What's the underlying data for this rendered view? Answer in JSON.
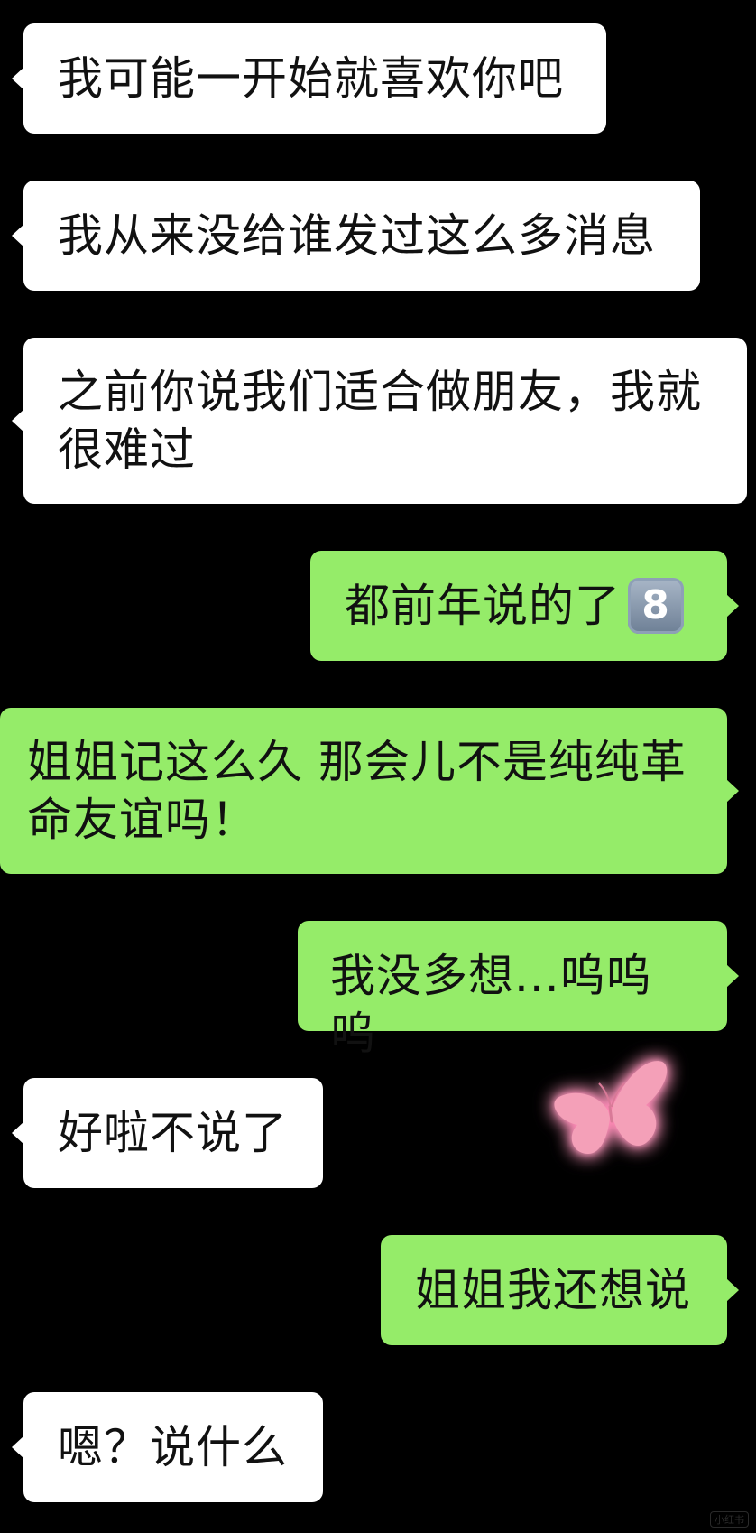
{
  "messages": [
    {
      "side": "in",
      "text": "我可能一开始就喜欢你吧"
    },
    {
      "side": "in",
      "text": "我从来没给谁发过这么多消息"
    },
    {
      "side": "in",
      "text": "之前你说我们适合做朋友，我就很难过"
    },
    {
      "side": "out",
      "text": "都前年说的了",
      "emoji": "8"
    },
    {
      "side": "out",
      "text": "姐姐记这么久 那会儿不是纯纯革命友谊吗！"
    },
    {
      "side": "out",
      "text": "我没多想...呜呜呜"
    },
    {
      "side": "in",
      "text": "好啦不说了"
    },
    {
      "side": "out",
      "text": "姐姐我还想说"
    },
    {
      "side": "in",
      "text": "嗯？说什么"
    }
  ],
  "decoration": {
    "sticker": "butterfly-icon",
    "sticker_color": "#f4a0b8"
  },
  "watermark": "小红书",
  "colors": {
    "background": "#000000",
    "incoming_bubble": "#ffffff",
    "outgoing_bubble": "#95ec69",
    "text": "#111111"
  }
}
